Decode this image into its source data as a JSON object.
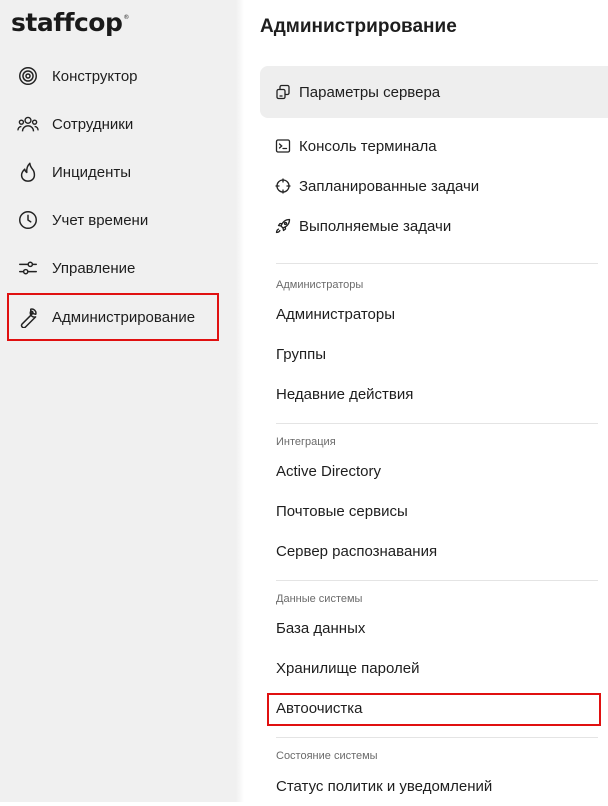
{
  "app": {
    "logo_text": "staffcop",
    "logo_mark": "®"
  },
  "sidebar": {
    "items": [
      {
        "label": "Конструктор",
        "icon": "target-icon"
      },
      {
        "label": "Сотрудники",
        "icon": "users-icon"
      },
      {
        "label": "Инциденты",
        "icon": "flame-icon"
      },
      {
        "label": "Учет времени",
        "icon": "clock-icon"
      },
      {
        "label": "Управление",
        "icon": "sliders-icon"
      },
      {
        "label": "Администрирование",
        "icon": "wrench-icon",
        "active": true
      }
    ]
  },
  "main": {
    "title": "Администрирование",
    "top_items": [
      {
        "label": "Параметры сервера",
        "icon": "server-params-icon",
        "selected": true
      },
      {
        "label": "Консоль терминала",
        "icon": "terminal-icon"
      },
      {
        "label": "Запланированные задачи",
        "icon": "crosshair-icon"
      },
      {
        "label": "Выполняемые задачи",
        "icon": "rocket-icon"
      }
    ],
    "sections": [
      {
        "title": "Администраторы",
        "items": [
          "Администраторы",
          "Группы",
          "Недавние действия"
        ]
      },
      {
        "title": "Интеграция",
        "items": [
          "Active Directory",
          "Почтовые сервисы",
          "Сервер распознавания"
        ]
      },
      {
        "title": "Данные системы",
        "items": [
          "База данных",
          "Хранилище паролей",
          "Автоочистка"
        ]
      },
      {
        "title": "Состояние системы",
        "items": [
          "Статус политик и уведомлений"
        ]
      }
    ]
  },
  "colors": {
    "highlight": "#e01010",
    "sidebar_bg": "#f0f0f0",
    "selected_bg": "#eeeeee"
  }
}
